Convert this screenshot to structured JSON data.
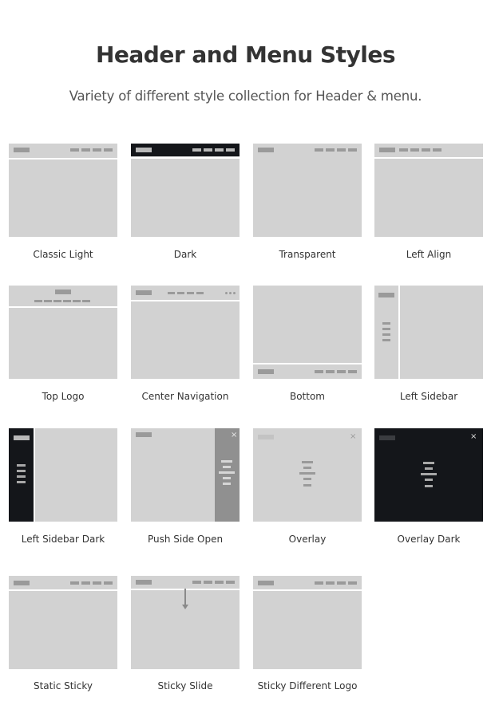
{
  "header": {
    "title": "Header and Menu Styles",
    "subtitle": "Variety of different style collection for Header & menu."
  },
  "styles": [
    {
      "label": "Classic Light",
      "variant": "classic-light"
    },
    {
      "label": "Dark",
      "variant": "dark"
    },
    {
      "label": "Transparent",
      "variant": "transparent"
    },
    {
      "label": "Left Align",
      "variant": "left-align"
    },
    {
      "label": "Top Logo",
      "variant": "top-logo"
    },
    {
      "label": "Center Navigation",
      "variant": "center-navigation"
    },
    {
      "label": "Bottom",
      "variant": "bottom"
    },
    {
      "label": "Left Sidebar",
      "variant": "left-sidebar"
    },
    {
      "label": "Left Sidebar Dark",
      "variant": "left-sidebar-dark"
    },
    {
      "label": "Push Side Open",
      "variant": "push-side-open"
    },
    {
      "label": "Overlay",
      "variant": "overlay"
    },
    {
      "label": "Overlay Dark",
      "variant": "overlay-dark"
    },
    {
      "label": "Static Sticky",
      "variant": "static-sticky"
    },
    {
      "label": "Sticky Slide",
      "variant": "sticky-slide"
    },
    {
      "label": "Sticky Different Logo",
      "variant": "sticky-different-logo"
    }
  ],
  "icons": {
    "close": "×"
  },
  "colors": {
    "thumb_bg": "#d2d2d2",
    "dark_bg": "#14161a",
    "placeholder": "#9a9a9a",
    "push_panel": "#909090"
  }
}
